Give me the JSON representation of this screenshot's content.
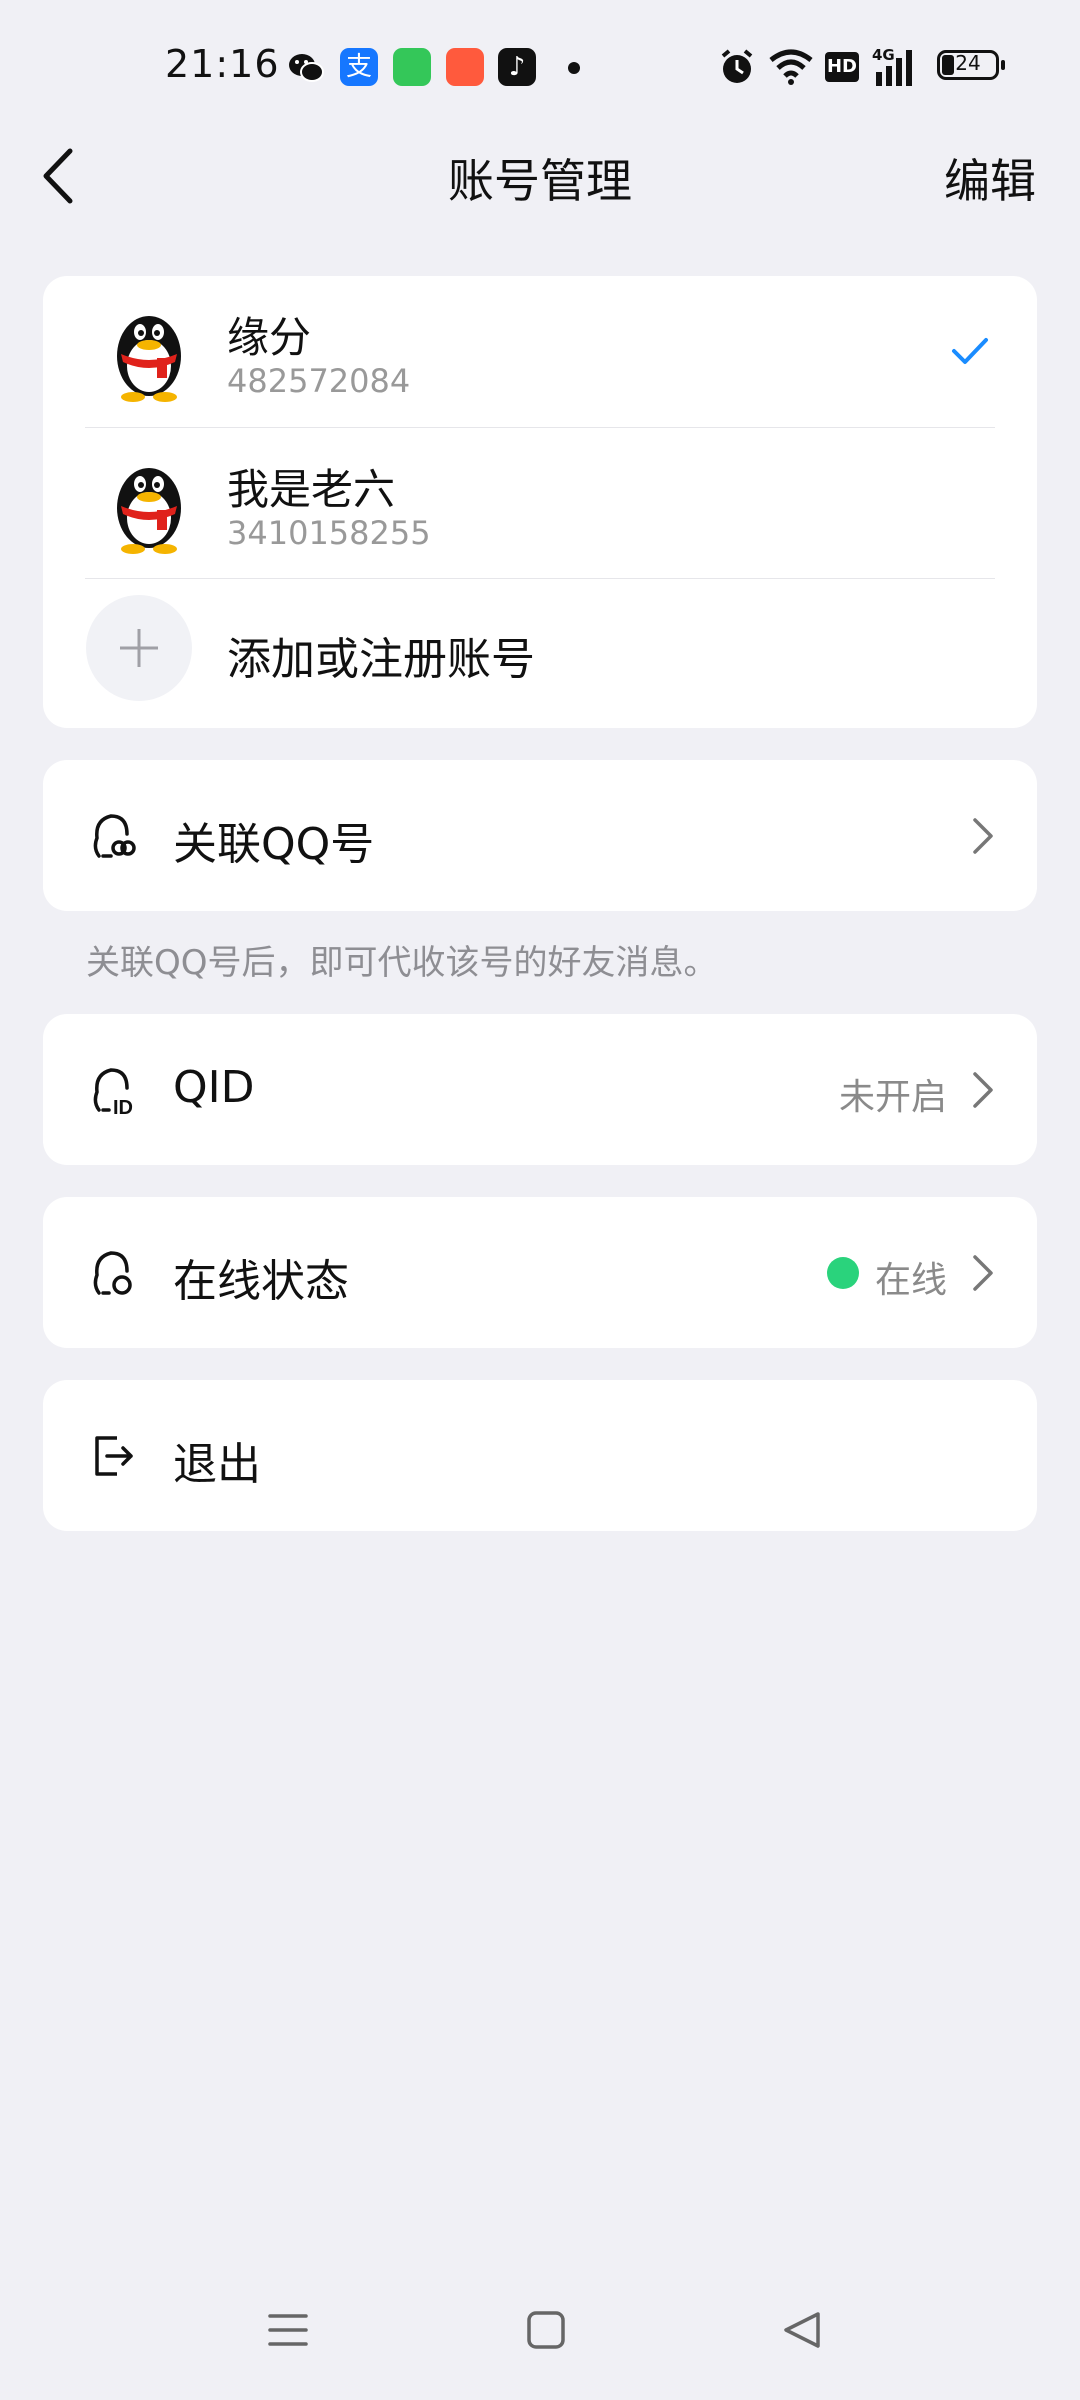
{
  "status_bar": {
    "time": "21:16",
    "icons": [
      "wechat-icon",
      "alipay-icon",
      "app-store-icon",
      "kuaishou-icon",
      "tiktok-icon",
      "alarm-icon",
      "wifi-icon",
      "hd-icon",
      "signal-4g-icon"
    ],
    "hd_label": "HD",
    "network_label": "4G",
    "battery": "24"
  },
  "header": {
    "title": "账号管理",
    "edit_label": "编辑"
  },
  "accounts": [
    {
      "name": "缘分",
      "id": "482572084",
      "selected": true
    },
    {
      "name": "我是老六",
      "id": "3410158255",
      "selected": false
    }
  ],
  "add_account_label": "添加或注册账号",
  "link_qq": {
    "label": "关联QQ号",
    "hint": "关联QQ号后，即可代收该号的好友消息。"
  },
  "qid": {
    "label": "QID",
    "value": "未开启"
  },
  "online_status": {
    "label": "在线状态",
    "value": "在线",
    "color": "#2ad37c"
  },
  "logout": {
    "label": "退出"
  },
  "nav": [
    "menu-icon",
    "home-icon",
    "back-triangle-icon"
  ]
}
